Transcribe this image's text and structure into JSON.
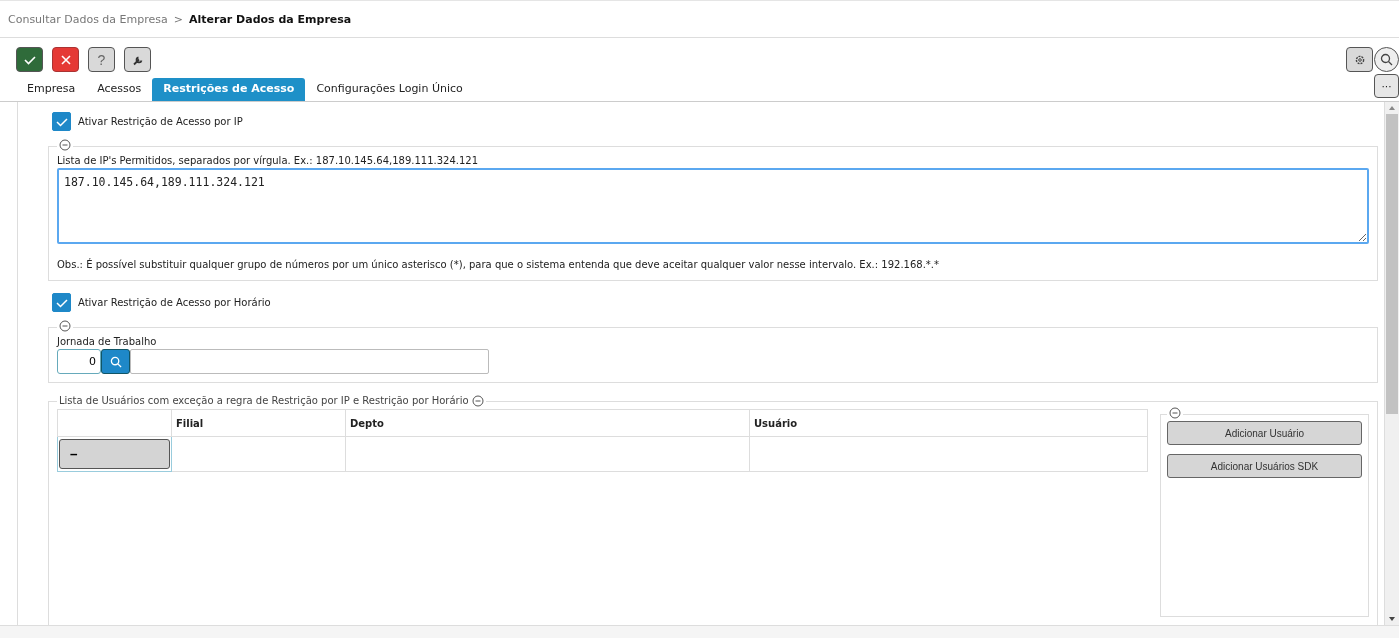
{
  "breadcrumb": {
    "parent": "Consultar Dados da Empresa",
    "separator": ">",
    "current": "Alterar Dados da Empresa"
  },
  "toolbar": {
    "help_label": "?",
    "more_label": "···"
  },
  "tabs": [
    {
      "label": "Empresa",
      "selected": false
    },
    {
      "label": "Acessos",
      "selected": false
    },
    {
      "label": "Restrições de Acesso",
      "selected": true
    },
    {
      "label": "Configurações Login Único",
      "selected": false
    }
  ],
  "ip_restriction": {
    "label": "Ativar Restrição de Acesso por IP",
    "checked": true,
    "field_label": "Lista de IP's Permitidos, separados por vírgula. Ex.: 187.10.145.64,189.111.324.121",
    "value": "187.10.145.64,189.111.324.121",
    "note": "Obs.: É possível substituir qualquer grupo de números por um único asterisco (*), para que o sistema entenda que deve aceitar qualquer valor nesse intervalo. Ex.: 192.168.*.*"
  },
  "time_restriction": {
    "label": "Ativar Restrição de Acesso por Horário",
    "checked": true,
    "field_label": "Jornada de Trabalho",
    "value": "0"
  },
  "exceptions": {
    "legend": "Lista de Usuários com exceção a regra de Restrição por IP e Restrição por Horário",
    "columns": [
      "",
      "Filial",
      "Depto",
      "Usuário"
    ],
    "rows": [
      {
        "button": "−",
        "cells": [
          "",
          "",
          ""
        ]
      }
    ],
    "buttons": [
      "Adicionar Usuário",
      "Adicionar Usuários SDK"
    ]
  }
}
